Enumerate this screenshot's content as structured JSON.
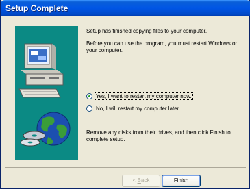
{
  "window": {
    "title": "Setup Complete"
  },
  "content": {
    "intro": "Setup has finished copying files to your computer.",
    "restart_notice": "Before you can use the program, you must restart Windows or your computer.",
    "options": [
      {
        "label": "Yes, I want to restart my computer now.",
        "selected": true
      },
      {
        "label": "No, I will restart my computer later.",
        "selected": false
      }
    ],
    "footer_note": "Remove any disks from their drives, and then click Finish to complete setup."
  },
  "buttons": {
    "back_prefix": "< ",
    "back_access_key": "B",
    "back_rest": "ack",
    "finish": "Finish"
  },
  "colors": {
    "titlebar": "#0055e5",
    "art_background": "#0b8a84",
    "dialog": "#ece9d8"
  },
  "icons": {
    "art": "computer-and-disks-illustration"
  }
}
